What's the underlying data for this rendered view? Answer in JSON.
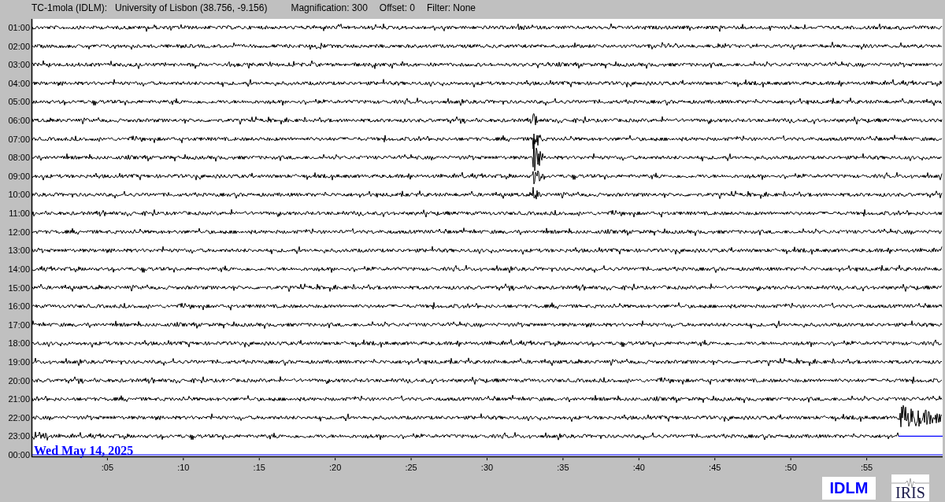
{
  "header": {
    "station": "TC-1mola (IDLM):",
    "location": "University of Lisbon (38.756, -9.156)",
    "magnification": "Magnification: 300",
    "offset": "Offset: 0",
    "filter": "Filter: None"
  },
  "rows": [
    {
      "label": "01:00",
      "kind": "trace"
    },
    {
      "label": "02:00",
      "kind": "trace"
    },
    {
      "label": "03:00",
      "kind": "trace"
    },
    {
      "label": "04:00",
      "kind": "trace"
    },
    {
      "label": "05:00",
      "kind": "trace"
    },
    {
      "label": "06:00",
      "kind": "trace"
    },
    {
      "label": "07:00",
      "kind": "trace"
    },
    {
      "label": "08:00",
      "kind": "trace"
    },
    {
      "label": "09:00",
      "kind": "trace"
    },
    {
      "label": "10:00",
      "kind": "trace"
    },
    {
      "label": "11:00",
      "kind": "trace"
    },
    {
      "label": "12:00",
      "kind": "trace"
    },
    {
      "label": "13:00",
      "kind": "trace"
    },
    {
      "label": "14:00",
      "kind": "trace"
    },
    {
      "label": "15:00",
      "kind": "trace"
    },
    {
      "label": "16:00",
      "kind": "trace"
    },
    {
      "label": "17:00",
      "kind": "trace"
    },
    {
      "label": "18:00",
      "kind": "trace"
    },
    {
      "label": "19:00",
      "kind": "trace"
    },
    {
      "label": "20:00",
      "kind": "trace"
    },
    {
      "label": "21:00",
      "kind": "trace"
    },
    {
      "label": "22:00",
      "kind": "trace"
    },
    {
      "label": "23:00",
      "kind": "partial"
    },
    {
      "label": "00:00",
      "kind": "pending"
    }
  ],
  "date": "Wed May 14, 2025",
  "x_ticks": [
    ":05",
    ":10",
    ":15",
    ":20",
    ":25",
    ":30",
    ":35",
    ":40",
    ":45",
    ":50",
    ":55"
  ],
  "logos": {
    "station": "IDLM",
    "network": "IRIS"
  }
}
